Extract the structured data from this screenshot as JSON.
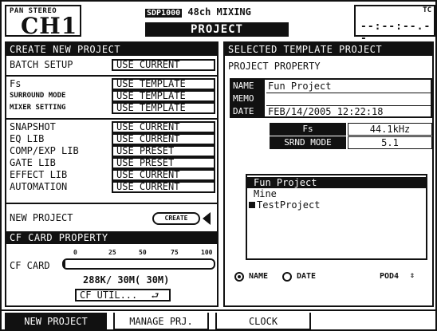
{
  "header": {
    "pan_label": "PAN STEREO",
    "channel": "CH1",
    "badge": "SDP1000",
    "model": "48ch MIXING",
    "screen_title": "PROJECT",
    "tc_label": "TC",
    "timecode": "--:--:--.--"
  },
  "create_new_project": {
    "section_title": "CREATE NEW PROJECT",
    "rows": [
      {
        "label": "BATCH SETUP",
        "value": "USE CURRENT"
      },
      {
        "label": "Fs",
        "value": "USE TEMPLATE"
      },
      {
        "label": "SURROUND MODE",
        "value": "USE TEMPLATE"
      },
      {
        "label": "MIXER SETTING",
        "value": "USE TEMPLATE"
      },
      {
        "label": "SNAPSHOT",
        "value": "USE CURRENT"
      },
      {
        "label": "EQ LIB",
        "value": "USE CURRENT"
      },
      {
        "label": "COMP/EXP LIB",
        "value": "USE PRESET"
      },
      {
        "label": "GATE LIB",
        "value": "USE PRESET"
      },
      {
        "label": "EFFECT LIB",
        "value": "USE CURRENT"
      },
      {
        "label": "AUTOMATION",
        "value": "USE CURRENT"
      }
    ],
    "new_project_label": "NEW PROJECT",
    "create_button": "CREATE"
  },
  "cf_card": {
    "section_title": "CF CARD PROPERTY",
    "label": "CF CARD",
    "scale": [
      "0",
      "25",
      "50",
      "75",
      "100"
    ],
    "used_fraction": 0.01,
    "stats": "288K/   30M(  30M)",
    "util_button": "CF UTIL..."
  },
  "template": {
    "section_title": "SELECTED TEMPLATE PROJECT",
    "property_title": "PROJECT PROPERTY",
    "name_label": "NAME",
    "name_value": "Fun Project",
    "memo_label": "MEMO",
    "memo_value": "",
    "date_label": "DATE",
    "date_value": "FEB/14/2005 12:22:18",
    "fs_label": "Fs",
    "fs_value": "44.1kHz",
    "srnd_label": "SRND MODE",
    "srnd_value": "5.1",
    "list": [
      "Fun Project",
      "Mine",
      "TestProject"
    ],
    "selected_index": 0,
    "sort_name": "NAME",
    "sort_date": "DATE",
    "pod": "POD4"
  },
  "tabs": [
    "NEW PROJECT",
    "MANAGE PRJ.",
    "CLOCK"
  ]
}
